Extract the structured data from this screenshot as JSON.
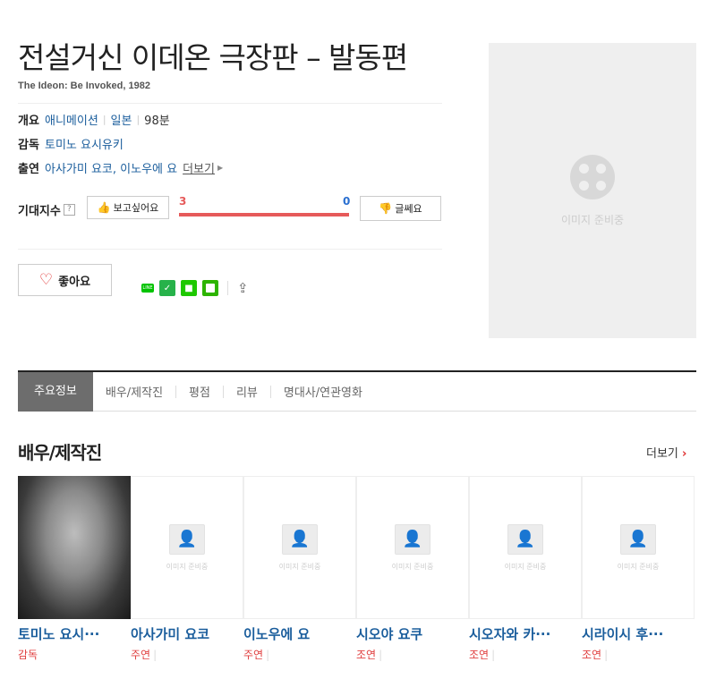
{
  "movie": {
    "title": "전설거신 이데온 극장판 – 발동편",
    "subtitle": "The Ideon: Be Invoked, 1982",
    "overview_label": "개요",
    "genre": "애니메이션",
    "country": "일본",
    "runtime": "98분",
    "director_label": "감독",
    "director": "토미노 요시유키",
    "cast_label": "출연",
    "cast": "아사가미 요코, 이노우에 요",
    "cast_more": "더보기"
  },
  "expect": {
    "label": "기대지수",
    "help": "?",
    "want_label": "보고싶어요",
    "want_count": "3",
    "meh_label": "글쎄요",
    "meh_count": "0",
    "want_fraction": 1.0
  },
  "like": {
    "label": "좋아요"
  },
  "share_icons": [
    "line-icon",
    "band-icon",
    "bookmark-icon",
    "kakao-icon",
    "share-icon"
  ],
  "poster": {
    "placeholder": "이미지 준비중"
  },
  "tabs": [
    "주요정보",
    "배우/제작진",
    "평점",
    "리뷰",
    "명대사/연관영화"
  ],
  "crew_section": {
    "title": "배우/제작진",
    "more": "더보기",
    "image_placeholder": "이미지 준비중",
    "people": [
      {
        "name": "토미노 요시···",
        "role": "감독",
        "has_photo": true
      },
      {
        "name": "아사가미 요코",
        "role": "주연",
        "has_photo": false
      },
      {
        "name": "이노우에 요",
        "role": "주연",
        "has_photo": false
      },
      {
        "name": "시오야 요쿠",
        "role": "조연",
        "has_photo": false
      },
      {
        "name": "시오자와 카···",
        "role": "조연",
        "has_photo": false
      },
      {
        "name": "시라이시 후···",
        "role": "조연",
        "has_photo": false
      }
    ]
  }
}
